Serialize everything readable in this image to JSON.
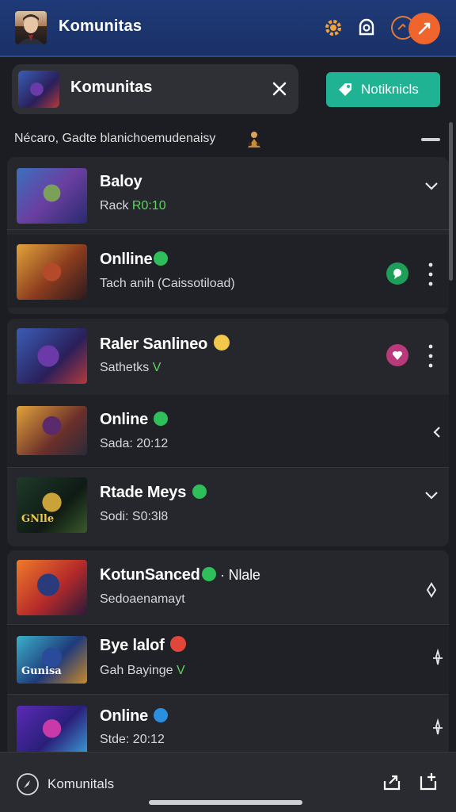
{
  "header": {
    "title": "Komunitas",
    "accent_color": "#f0652c"
  },
  "search": {
    "label": "Komunitas",
    "close_icon": "close-icon"
  },
  "notification_button": {
    "label": "Notiknicls",
    "color": "#1fb394"
  },
  "subline": "Nécaro, Gadte blanichoemudenaisy",
  "groups": [
    {
      "rows": [
        {
          "name": "Baloy",
          "sub_prefix": "Rack ",
          "sub_highlight": "R0:10",
          "action": "chevron-down-icon"
        },
        {
          "name": "Onlline",
          "sub": "Tach anih (Caissotiload)",
          "status": "online",
          "badge_color": "#1f9e5a",
          "action": "more-vertical-icon"
        }
      ]
    },
    {
      "rows": [
        {
          "name": "Raler Sanlineo",
          "sub_prefix": "Sathetks ",
          "sub_highlight": "V",
          "badge_color": "#b83a7a",
          "emoji": "neutral",
          "action": "more-vertical-icon"
        },
        {
          "name": "Online",
          "sub": "Sada: 20:12",
          "status": "online",
          "action": "chevron-left-icon"
        },
        {
          "name": "Rtade Meys",
          "sub": "Sodi: S0:3l8",
          "status": "online",
          "art_label": "GNlle",
          "action": "chevron-down-icon"
        }
      ]
    },
    {
      "rows": [
        {
          "name": "KotunSanced",
          "name_suffix": "· Nlale",
          "sub": "Sedoaenamayt",
          "status": "online",
          "action": "diamond-icon"
        },
        {
          "name": "Bye lalof",
          "sub_prefix": "Gah Bayinge ",
          "sub_highlight": "V",
          "art_label": "Gunisa",
          "emoji": "angry",
          "action": "sparkle-icon"
        },
        {
          "name": "Online",
          "sub": "Stde: 20:12",
          "status": "info",
          "action": "sparkle-icon"
        }
      ]
    }
  ],
  "bottom_bar": {
    "label": "Komunitals"
  }
}
